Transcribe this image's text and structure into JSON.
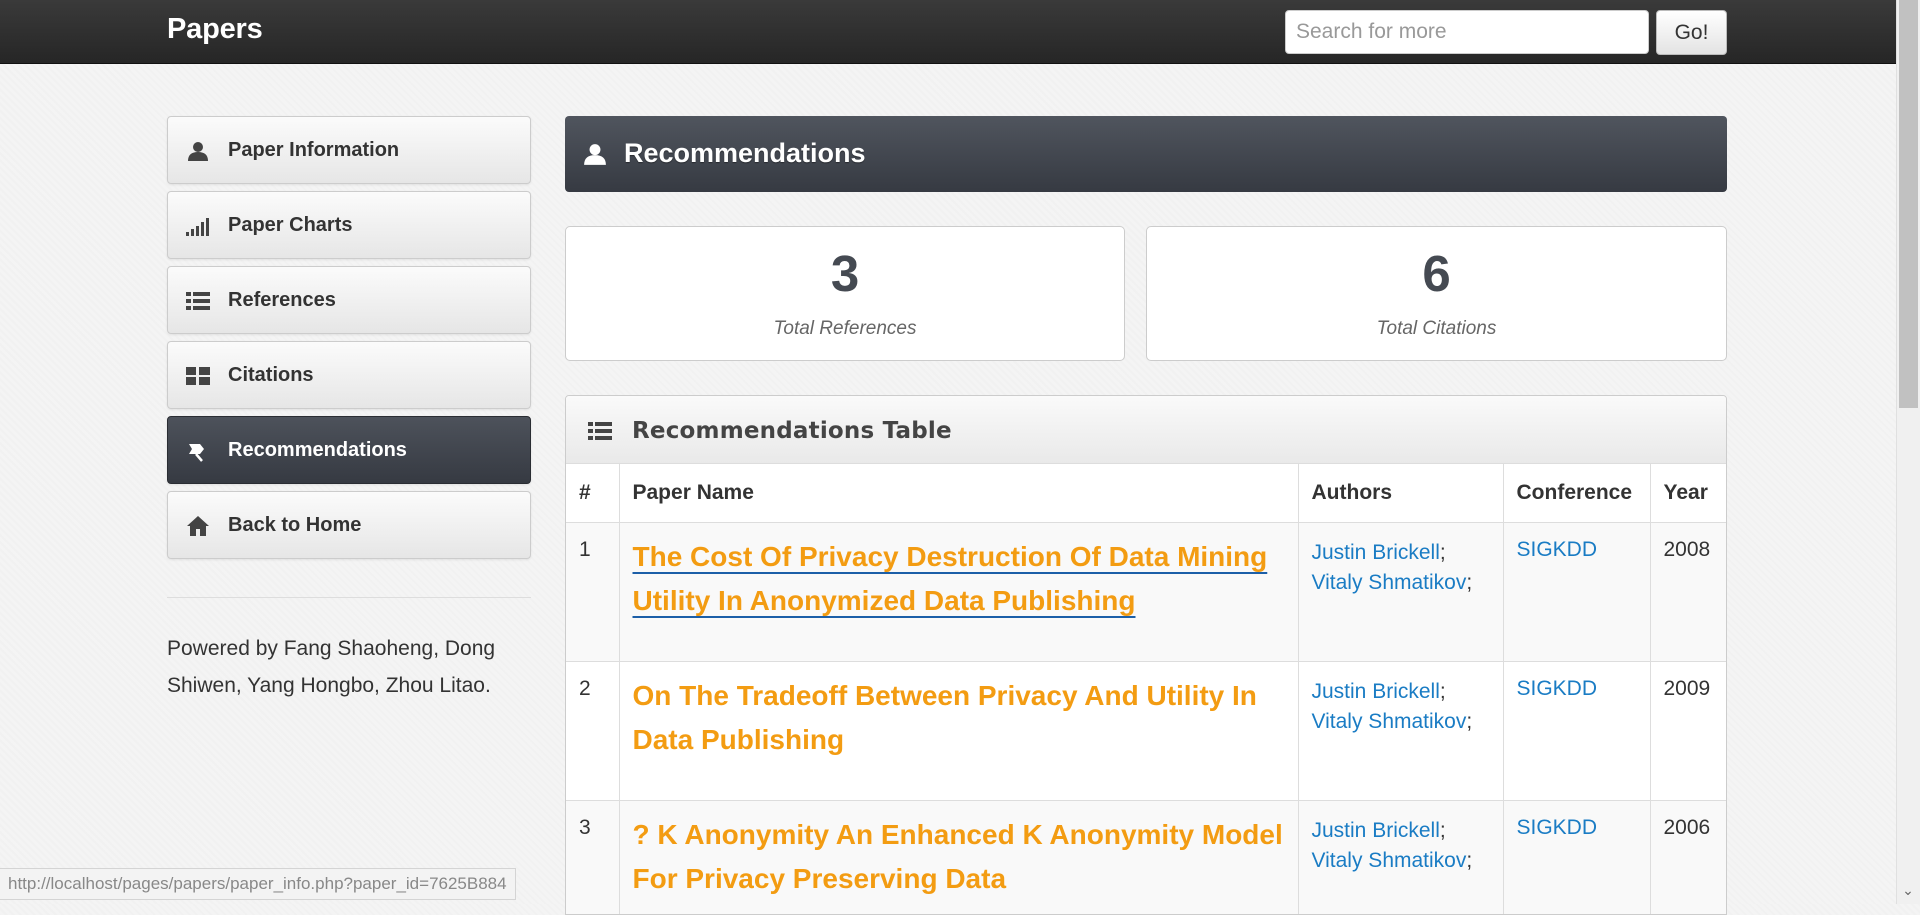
{
  "navbar": {
    "brand": "Papers",
    "search_placeholder": "Search for more",
    "go_label": "Go!"
  },
  "sidebar": {
    "items": [
      {
        "label": "Paper Information",
        "icon": "user-icon"
      },
      {
        "label": "Paper Charts",
        "icon": "signal-icon"
      },
      {
        "label": "References",
        "icon": "list-icon"
      },
      {
        "label": "Citations",
        "icon": "grid-icon"
      },
      {
        "label": "Recommendations",
        "icon": "pin-icon",
        "active": true
      },
      {
        "label": "Back to Home",
        "icon": "home-icon"
      }
    ],
    "powered_by": "Powered by Fang Shaoheng, Dong Shiwen, Yang Hongbo, Zhou Litao."
  },
  "main": {
    "header_title": "Recommendations",
    "stats": {
      "references_count": "3",
      "references_label": "Total References",
      "citations_count": "6",
      "citations_label": "Total Citations"
    },
    "table": {
      "title": "Recommendations Table",
      "columns": [
        "#",
        "Paper Name",
        "Authors",
        "Conference",
        "Year"
      ],
      "rows": [
        {
          "num": "1",
          "name": "The Cost Of Privacy Destruction Of Data Mining Utility In Anonymized Data Publishing",
          "authors": [
            "Justin Brickell",
            "Vitaly Shmatikov"
          ],
          "conference": "SIGKDD",
          "year": "2008"
        },
        {
          "num": "2",
          "name": "On The Tradeoff Between Privacy And Utility In Data Publishing",
          "authors": [
            "Justin Brickell",
            "Vitaly Shmatikov"
          ],
          "conference": "SIGKDD",
          "year": "2009"
        },
        {
          "num": "3",
          "name": "? K Anonymity An Enhanced K Anonymity Model For Privacy Preserving Data",
          "authors": [
            "Justin Brickell",
            "Vitaly Shmatikov"
          ],
          "conference": "SIGKDD",
          "year": "2006"
        }
      ]
    }
  },
  "status_bar": {
    "url": "http://localhost/pages/papers/paper_info.php?paper_id=7625B884"
  },
  "colors": {
    "navbar_bg": "#2d2d2d",
    "active_bg": "#3f434b",
    "paper_link": "#f39c12",
    "author_link": "#1a7cc4"
  }
}
